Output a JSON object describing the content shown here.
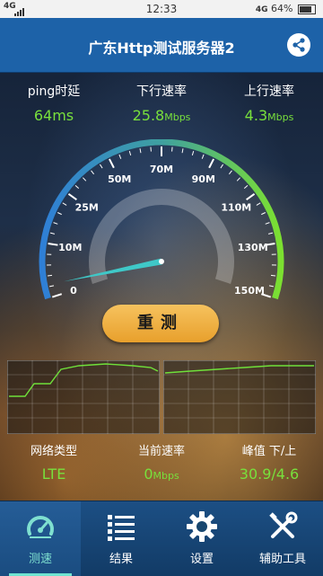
{
  "status_bar": {
    "network": "4G",
    "time": "12:33",
    "right_network": "4G",
    "battery": "64%"
  },
  "header": {
    "title": "广东Http测试服务器2",
    "share_icon": "share-icon"
  },
  "stats": {
    "ping_label": "ping时延",
    "ping_value": "64",
    "ping_unit": "ms",
    "download_label": "下行速率",
    "download_value": "25.8",
    "download_unit": "Mbps",
    "upload_label": "上行速率",
    "upload_value": "4.3",
    "upload_unit": "Mbps"
  },
  "gauge": {
    "ticks": [
      "0",
      "10M",
      "25M",
      "50M",
      "70M",
      "90M",
      "110M",
      "130M",
      "150M"
    ],
    "needle_fraction": 0.03,
    "colors": {
      "low": "#2f7fd6",
      "mid": "#3fa0a0",
      "high": "#7ce030"
    }
  },
  "retest_label": "重测",
  "bottom_stats": {
    "network_type_label": "网络类型",
    "network_type_value": "LTE",
    "current_rate_label": "当前速率",
    "current_rate_value": "0",
    "current_rate_unit": "Mbps",
    "peak_label": "峰值 下/上",
    "peak_value": "30.9/4.6"
  },
  "nav": {
    "items": [
      {
        "label": "测速",
        "icon": "speedometer-icon",
        "active": true
      },
      {
        "label": "结果",
        "icon": "list-icon",
        "active": false
      },
      {
        "label": "设置",
        "icon": "gear-icon",
        "active": false
      },
      {
        "label": "辅助工具",
        "icon": "tools-icon",
        "active": false
      }
    ]
  },
  "accent": "#78e03c"
}
